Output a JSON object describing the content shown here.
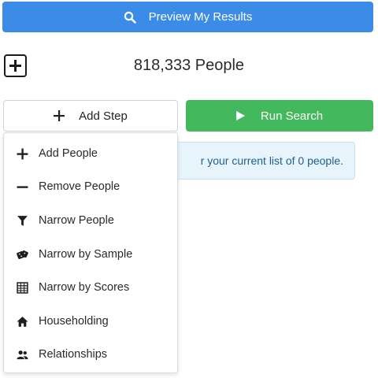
{
  "preview_button": {
    "label": "Preview My Results",
    "icon": "search-icon"
  },
  "expand_button": {
    "icon": "plus-square-icon"
  },
  "people_count": "818,333 People",
  "add_step_button": {
    "label": "Add Step",
    "icon": "plus-icon"
  },
  "run_search_button": {
    "label": "Run Search",
    "icon": "play-icon"
  },
  "info_message": "r your current list of 0 people.",
  "menu": {
    "items": [
      {
        "label": "Add People",
        "icon": "plus-icon"
      },
      {
        "label": "Remove People",
        "icon": "minus-icon"
      },
      {
        "label": "Narrow People",
        "icon": "filter-icon"
      },
      {
        "label": "Narrow by Sample",
        "icon": "dice-icon"
      },
      {
        "label": "Narrow by Scores",
        "icon": "table-icon"
      },
      {
        "label": "Householding",
        "icon": "home-icon"
      },
      {
        "label": "Relationships",
        "icon": "users-icon"
      }
    ]
  },
  "colors": {
    "primary": "#3a8ce6",
    "success": "#44b85c",
    "info_bg": "#e8f4fc",
    "info_text": "#1d5f8c"
  }
}
